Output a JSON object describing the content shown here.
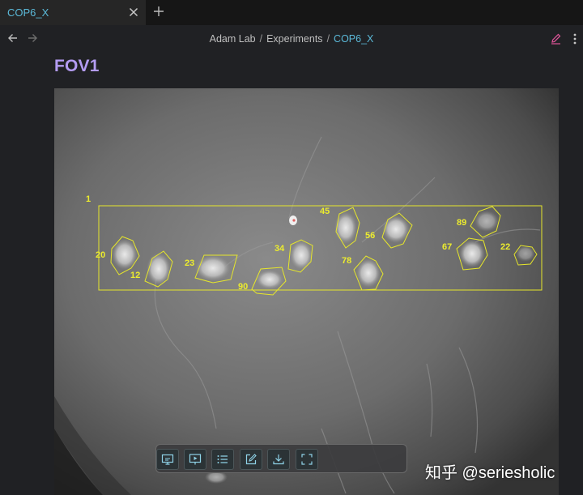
{
  "tabs": [
    {
      "title": "COP6_X",
      "active": true
    }
  ],
  "breadcrumb": {
    "items": [
      "Adam Lab",
      "Experiments",
      "COP6_X"
    ],
    "separator": "/"
  },
  "page": {
    "title": "FOV1"
  },
  "image": {
    "bounding_roi_label": "1",
    "roi_labels": [
      "45",
      "56",
      "89",
      "20",
      "12",
      "23",
      "34",
      "90",
      "78",
      "67",
      "22"
    ]
  },
  "toolbar": {
    "buttons": [
      "presentation-icon",
      "play-slide-icon",
      "list-icon",
      "edit-icon",
      "download-icon",
      "fullscreen-icon"
    ]
  },
  "watermark": {
    "text": "知乎 @seriesholic"
  },
  "colors": {
    "accent": "#5bb9d8",
    "title": "#b39cf2",
    "roi": "#e6e62b",
    "edit_icon": "#e0559a"
  }
}
